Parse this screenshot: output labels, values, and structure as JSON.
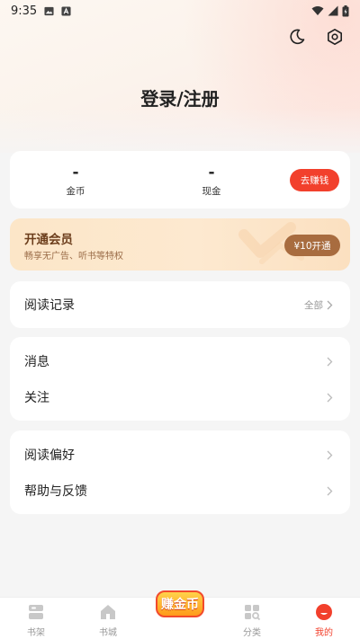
{
  "status_bar": {
    "time": "9:35"
  },
  "header": {
    "login_label": "登录/注册"
  },
  "wallet": {
    "coins": {
      "value": "-",
      "label": "金币"
    },
    "cash": {
      "value": "-",
      "label": "现金"
    },
    "earn_button": "去赚钱"
  },
  "vip": {
    "title": "开通会员",
    "subtitle": "畅享无广告、听书等特权",
    "button": "¥10开通"
  },
  "reading_history": {
    "label": "阅读记录",
    "extra": "全部"
  },
  "group1": {
    "messages": "消息",
    "follow": "关注"
  },
  "group2": {
    "preferences": "阅读偏好",
    "help": "帮助与反馈"
  },
  "bottom_nav": {
    "bookshelf": "书架",
    "bookstore": "书城",
    "earn_coins": "赚金币",
    "category": "分类",
    "mine": "我的"
  },
  "colors": {
    "accent": "#f2402c",
    "vip_button": "#a86c3f"
  }
}
